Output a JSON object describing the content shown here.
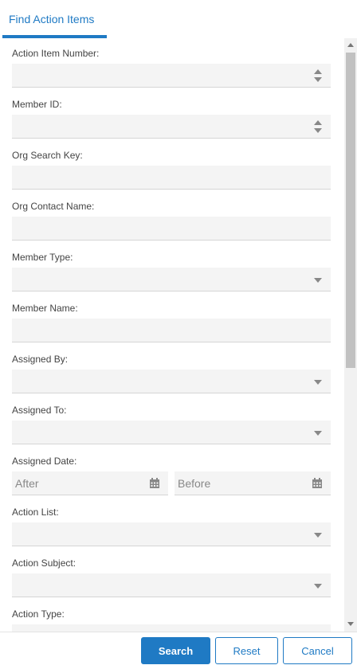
{
  "tab": {
    "label": "Find Action Items"
  },
  "fields": {
    "action_item_number": {
      "label": "Action Item Number:",
      "value": ""
    },
    "member_id": {
      "label": "Member ID:",
      "value": ""
    },
    "org_search_key": {
      "label": "Org Search Key:",
      "value": ""
    },
    "org_contact_name": {
      "label": "Org Contact Name:",
      "value": ""
    },
    "member_type": {
      "label": "Member Type:",
      "value": ""
    },
    "member_name": {
      "label": "Member Name:",
      "value": ""
    },
    "assigned_by": {
      "label": "Assigned By:",
      "value": ""
    },
    "assigned_to": {
      "label": "Assigned To:",
      "value": ""
    },
    "assigned_date": {
      "label": "Assigned Date:",
      "after_placeholder": "After",
      "before_placeholder": "Before"
    },
    "action_list": {
      "label": "Action List:",
      "value": ""
    },
    "action_subject": {
      "label": "Action Subject:",
      "value": ""
    },
    "action_type": {
      "label": "Action Type:",
      "value": ""
    }
  },
  "buttons": {
    "search": "Search",
    "reset": "Reset",
    "cancel": "Cancel"
  },
  "colors": {
    "accent": "#1f7ac4",
    "field_bg": "#f4f4f4"
  }
}
